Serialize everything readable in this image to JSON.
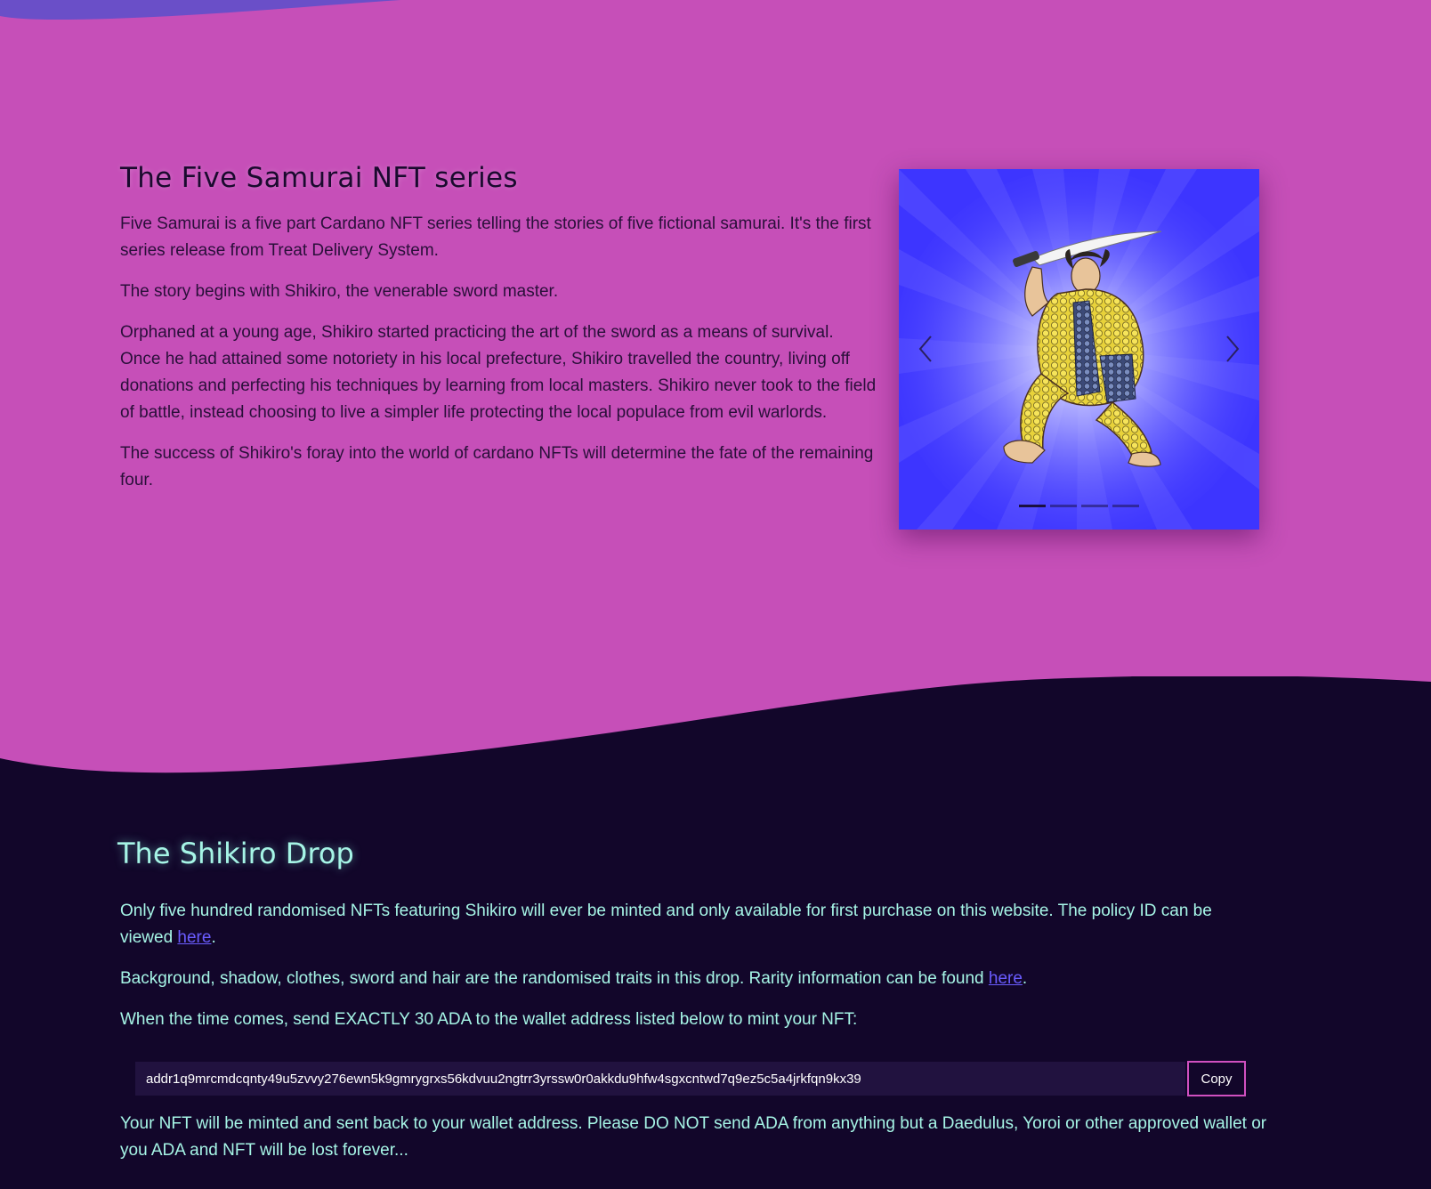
{
  "colors": {
    "section_bg": "#c64fb8",
    "dark_bg": "#12062a",
    "accent_teal": "#a6f5e6",
    "link": "#6a5cff",
    "carousel_bg": "#3d35ff"
  },
  "series": {
    "title": "The Five Samurai NFT series",
    "paragraphs": [
      "Five Samurai is a five part Cardano NFT series telling the stories of five fictional samurai. It's the first series release from Treat Delivery System.",
      "The story begins with Shikiro, the venerable sword master.",
      "Orphaned at a young age, Shikiro started practicing the art of the sword as a means of survival. Once he had attained some notoriety in his local prefecture, Shikiro travelled the country, living off donations and perfecting his techniques by learning from local masters. Shikiro never took to the field of battle, instead choosing to live a simpler life protecting the local populace from evil warlords.",
      "The success of Shikiro's foray into the world of cardano NFTs will determine the fate of the remaining four."
    ]
  },
  "carousel": {
    "prev_icon": "chevron-left-icon",
    "next_icon": "chevron-right-icon",
    "slide_count": 4,
    "active_index": 0
  },
  "drop": {
    "title": "The Shikiro Drop",
    "p1_text": "Only five hundred randomised NFTs featuring Shikiro will ever be minted and only available for first purchase on this website. The policy ID can be viewed ",
    "p1_link": "here",
    "p1_end": ".",
    "p2_text": "Background, shadow, clothes, sword and hair are the randomised traits in this drop. Rarity information can be found ",
    "p2_link": "here",
    "p2_end": ".",
    "p3_text": "When the time comes, send EXACTLY 30 ADA to the wallet address listed below to mint your NFT:",
    "address": "addr1q9mrcmdcqnty49u5zvvy276ewn5k9gmrygrxs56kdvuu2ngtrr3yrssw0r0akkdu9hfw4sgxcntwd7q9ez5c5a4jrkfqn9kx39",
    "copy_label": "Copy",
    "p4_text": "Your NFT will be minted and sent back to your wallet address. Please DO NOT send ADA from anything but a Daedulus, Yoroi or other approved wallet or you ADA and NFT will be lost forever..."
  }
}
